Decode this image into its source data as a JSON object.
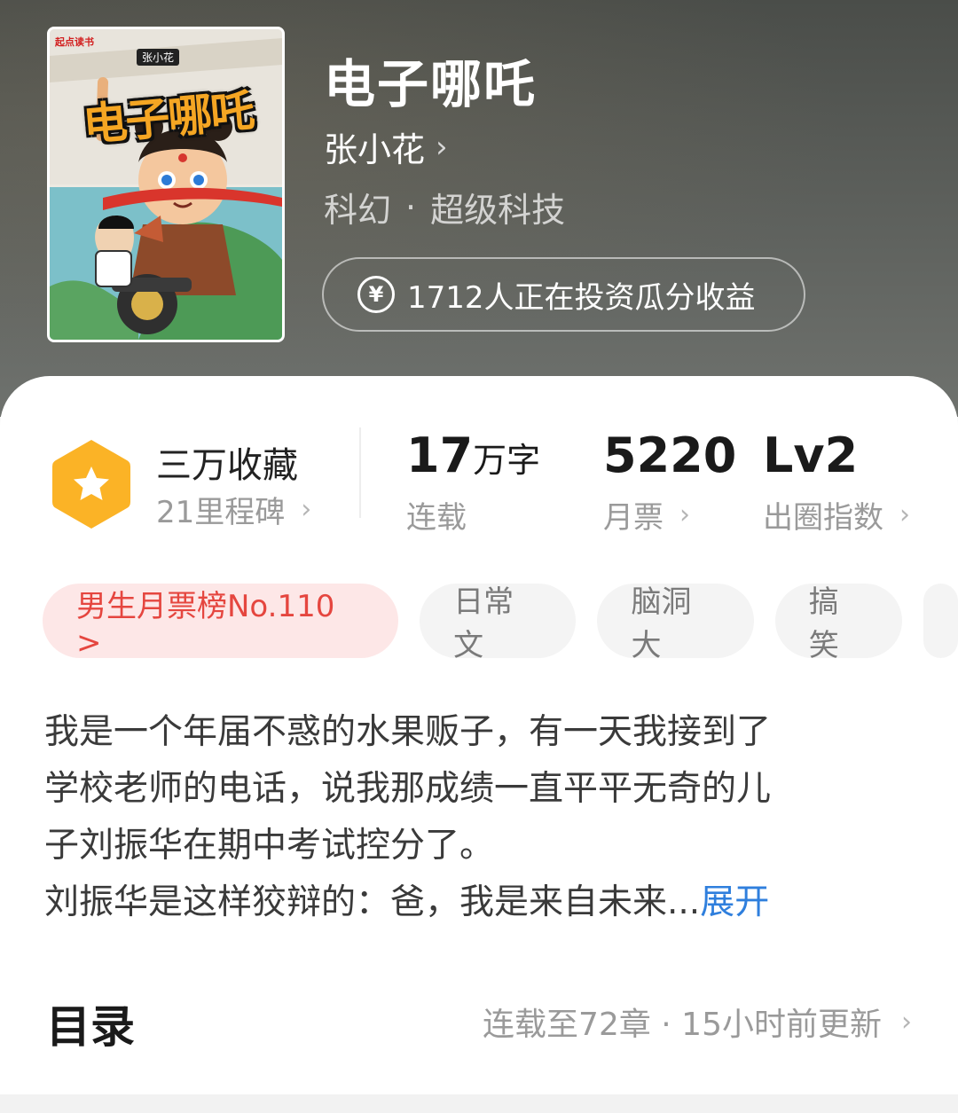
{
  "header": {
    "cover": {
      "brand": "起点读书",
      "author_badge": "张小花",
      "title_art": "电子哪吒"
    },
    "title": "电子哪吒",
    "author": "张小花",
    "author_chevron": "›",
    "genre": "科幻",
    "genre_separator": "·",
    "subgenre": "超级科技",
    "invest_icon": "yen-coin-icon",
    "invest_text": "1712人正在投资瓜分收益"
  },
  "stats": {
    "collection": {
      "label": "三万收藏",
      "sub": "21里程碑",
      "icon": "star-hexagon-badge-icon",
      "badge_color": "#fbb326"
    },
    "words": {
      "value": "17",
      "unit": "万字",
      "sub": "连载"
    },
    "monthly_votes": {
      "value": "5220",
      "sub": "月票"
    },
    "influence": {
      "value": "Lv2",
      "sub": "出圈指数"
    },
    "chevron": "›"
  },
  "tags": {
    "rank": "男生月票榜No.110 >",
    "items": [
      "日常文",
      "脑洞大",
      "搞笑"
    ]
  },
  "synopsis": {
    "lines": [
      "我是一个年届不惑的水果贩子，有一天我接到了",
      "学校老师的电话，说我那成绩一直平平无奇的儿",
      "子刘振华在期中考试控分了。",
      "刘振华是这样狡辩的：爸，我是来自未来..."
    ],
    "expand_label": "展开"
  },
  "toc": {
    "title": "目录",
    "meta": "连载至72章 · 15小时前更新",
    "chevron": "›"
  },
  "colors": {
    "accent_red": "#e5463f",
    "link_blue": "#2f7fdd",
    "badge_orange": "#fbb326"
  }
}
